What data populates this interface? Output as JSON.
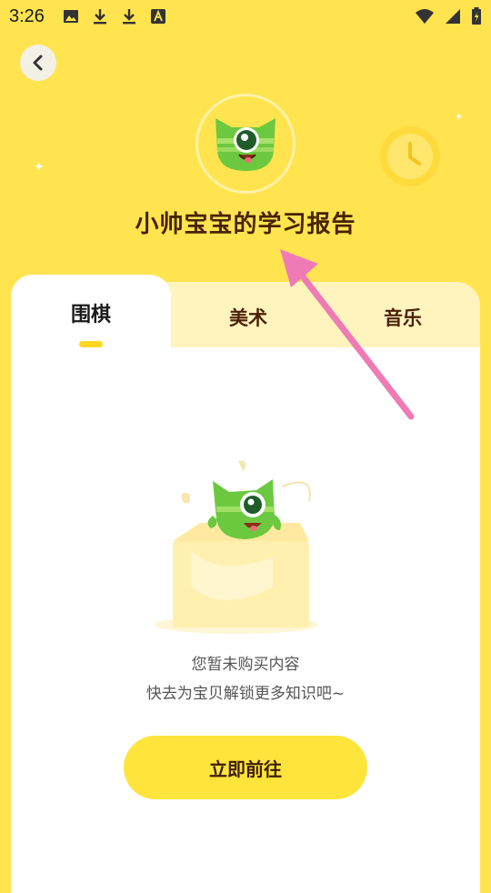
{
  "status_bar": {
    "time": "3:26",
    "left_icons": [
      "image-icon",
      "download-icon",
      "download-icon",
      "a-icon"
    ],
    "right_icons": [
      "wifi-icon",
      "signal-icon",
      "battery-icon"
    ]
  },
  "header": {
    "back_icon": "chevron-left-icon",
    "avatar_icon": "green-monster-avatar-icon",
    "title": "小帅宝宝的学习报告"
  },
  "tabs": [
    {
      "label": "围棋",
      "active": true
    },
    {
      "label": "美术",
      "active": false
    },
    {
      "label": "音乐",
      "active": false
    }
  ],
  "empty_state": {
    "illustration": "monster-in-box-icon",
    "line1": "您暂未购买内容",
    "line2": "快去为宝贝解锁更多知识吧~",
    "button_label": "立即前往"
  },
  "colors": {
    "background": "#FFE450",
    "title_text": "#4A2206",
    "tab_bar": "#FFF4BE",
    "button": "#FFE43C",
    "arrow": "#F07AB5"
  }
}
